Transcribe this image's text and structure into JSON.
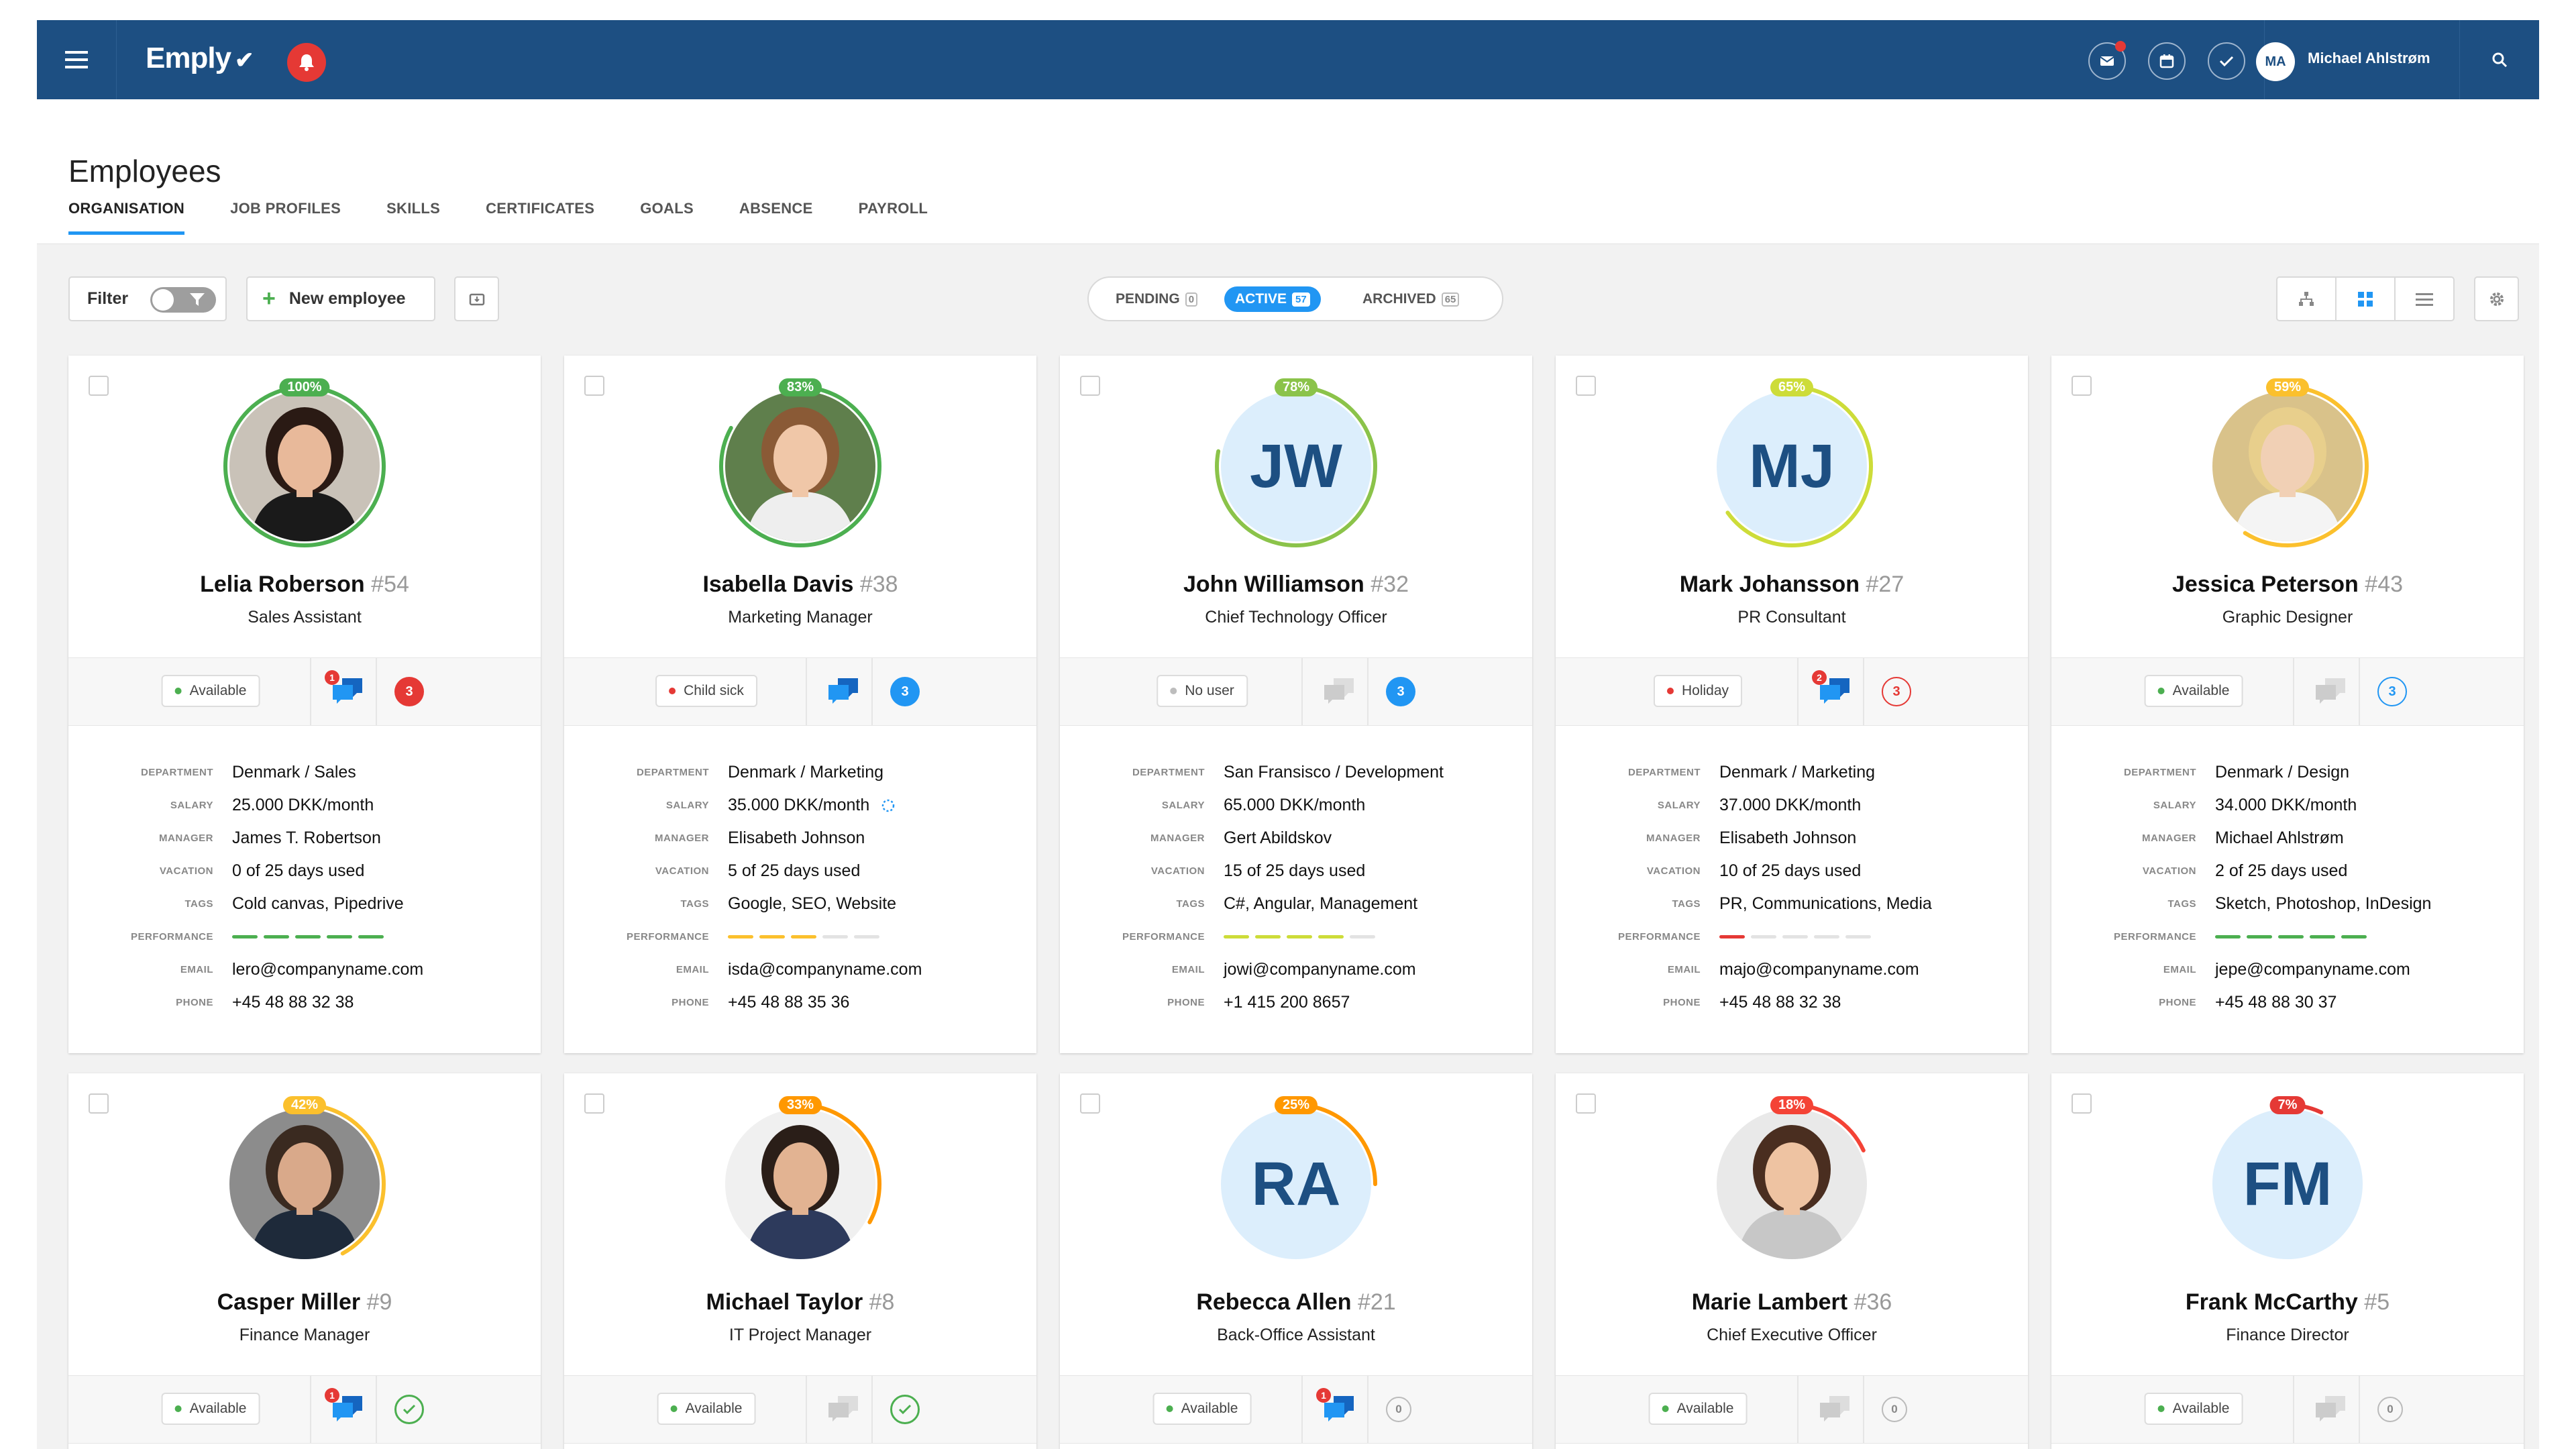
{
  "app": {
    "logo": "Emply",
    "user_initials": "MA",
    "user_name": "Michael Ahlstrøm"
  },
  "colors": {
    "brand": "#1d4f82",
    "accent": "#2196f3",
    "green": "#4caf50",
    "yellow": "#cddc39",
    "orange": "#ff9800",
    "red": "#e53935"
  },
  "header": {
    "title": "Employees",
    "tabs": [
      "ORGANISATION",
      "JOB PROFILES",
      "SKILLS",
      "CERTIFICATES",
      "GOALS",
      "ABSENCE",
      "PAYROLL"
    ]
  },
  "toolbar": {
    "filter_label": "Filter",
    "new_employee_label": "New employee",
    "segments": [
      {
        "label": "PENDING",
        "count": "0"
      },
      {
        "label": "ACTIVE",
        "count": "57"
      },
      {
        "label": "ARCHIVED",
        "count": "65"
      }
    ]
  },
  "labels": {
    "department": "DEPARTMENT",
    "salary": "SALARY",
    "manager": "MANAGER",
    "vacation": "VACATION",
    "tags": "TAGS",
    "performance": "PERFORMANCE",
    "email": "EMAIL",
    "phone": "PHONE"
  },
  "employees": [
    {
      "name": "Lelia Roberson",
      "number": "#54",
      "title": "Sales Assistant",
      "percent": "100%",
      "progress": 1.0,
      "ring_color": "#4caf50",
      "avatar_type": "photo",
      "photo_icon": "woman-dark-hair-photo",
      "status": "Available",
      "status_color": "#4caf50",
      "chat_active": true,
      "chat_badge": "1",
      "count": "3",
      "count_style": "filled-red",
      "department": "Denmark / Sales",
      "salary": "25.000 DKK/month",
      "manager": "James T. Robertson",
      "vacation": "0 of 25 days used",
      "tags": "Cold canvas, Pipedrive",
      "performance": 5,
      "performance_color": "#4caf50",
      "email": "lero@companyname.com",
      "phone": "+45 48 88 32 38"
    },
    {
      "name": "Isabella Davis",
      "number": "#38",
      "title": "Marketing Manager",
      "percent": "83%",
      "progress": 0.83,
      "ring_color": "#4caf50",
      "avatar_type": "photo",
      "photo_icon": "woman-smiling-photo",
      "status": "Child sick",
      "status_color": "#e53935",
      "chat_active": true,
      "chat_badge": "",
      "count": "3",
      "count_style": "filled-blue",
      "department": "Denmark / Marketing",
      "salary": "35.000 DKK/month",
      "salary_pending": true,
      "manager": "Elisabeth Johnson",
      "vacation": "5 of 25 days used",
      "tags": "Google, SEO, Website",
      "performance": 3,
      "performance_color": "#fbc02d",
      "email": "isda@companyname.com",
      "phone": "+45 48 88 35 36"
    },
    {
      "name": "John Williamson",
      "number": "#32",
      "title": "Chief Technology Officer",
      "percent": "78%",
      "progress": 0.78,
      "ring_color": "#8bc34a",
      "avatar_type": "initials",
      "initials": "JW",
      "status": "No user",
      "status_color": "#bdbdbd",
      "chat_active": false,
      "chat_badge": "",
      "count": "3",
      "count_style": "filled-blue",
      "department": "San Fransisco / Development",
      "salary": "65.000 DKK/month",
      "manager": "Gert Abildskov",
      "vacation": "15 of 25 days used",
      "tags": "C#, Angular, Management",
      "performance": 4,
      "performance_color": "#cddc39",
      "email": "jowi@companyname.com",
      "phone": "+1 415 200 8657"
    },
    {
      "name": "Mark Johansson",
      "number": "#27",
      "title": "PR Consultant",
      "percent": "65%",
      "progress": 0.65,
      "ring_color": "#cddc39",
      "avatar_type": "initials",
      "initials": "MJ",
      "status": "Holiday",
      "status_color": "#e53935",
      "chat_active": true,
      "chat_badge": "2",
      "count": "3",
      "count_style": "outline-red",
      "department": "Denmark / Marketing",
      "salary": "37.000 DKK/month",
      "manager": "Elisabeth Johnson",
      "vacation": "10 of 25 days used",
      "tags": "PR, Communications, Media",
      "performance": 1,
      "performance_color": "#e53935",
      "email": "majo@companyname.com",
      "phone": "+45 48 88 32 38"
    },
    {
      "name": "Jessica Peterson",
      "number": "#43",
      "title": "Graphic Designer",
      "percent": "59%",
      "progress": 0.59,
      "ring_color": "#fbc02d",
      "avatar_type": "photo",
      "photo_icon": "woman-blonde-sitting-photo",
      "status": "Available",
      "status_color": "#4caf50",
      "chat_active": false,
      "chat_badge": "",
      "count": "3",
      "count_style": "outline-blue",
      "department": "Denmark / Design",
      "salary": "34.000 DKK/month",
      "manager": "Michael Ahlstrøm",
      "vacation": "2 of 25 days used",
      "tags": "Sketch, Photoshop, InDesign",
      "performance": 5,
      "performance_color": "#4caf50",
      "email": "jepe@companyname.com",
      "phone": "+45 48 88 30 37"
    },
    {
      "name": "Casper Miller",
      "number": "#9",
      "title": "Finance Manager",
      "percent": "42%",
      "progress": 0.42,
      "ring_color": "#fbc02d",
      "avatar_type": "photo",
      "photo_icon": "man-suit-photo",
      "status": "Available",
      "status_color": "#4caf50",
      "chat_active": true,
      "chat_badge": "1",
      "count": "",
      "count_style": "check-green"
    },
    {
      "name": "Michael Taylor",
      "number": "#8",
      "title": "IT Project Manager",
      "percent": "33%",
      "progress": 0.33,
      "ring_color": "#ff9800",
      "avatar_type": "photo",
      "photo_icon": "man-smiling-photo",
      "status": "Available",
      "status_color": "#4caf50",
      "chat_active": false,
      "chat_badge": "",
      "count": "",
      "count_style": "check-green"
    },
    {
      "name": "Rebecca Allen",
      "number": "#21",
      "title": "Back-Office Assistant",
      "percent": "25%",
      "progress": 0.25,
      "ring_color": "#ff9800",
      "avatar_type": "initials",
      "initials": "RA",
      "status": "Available",
      "status_color": "#4caf50",
      "chat_active": true,
      "chat_badge": "1",
      "count": "0",
      "count_style": "outline-grey"
    },
    {
      "name": "Marie Lambert",
      "number": "#36",
      "title": "Chief Executive Officer",
      "percent": "18%",
      "progress": 0.18,
      "ring_color": "#f44336",
      "avatar_type": "photo",
      "photo_icon": "woman-office-photo",
      "status": "Available",
      "status_color": "#4caf50",
      "chat_active": false,
      "chat_badge": "",
      "count": "0",
      "count_style": "outline-grey"
    },
    {
      "name": "Frank McCarthy",
      "number": "#5",
      "title": "Finance Director",
      "percent": "7%",
      "progress": 0.07,
      "ring_color": "#e53935",
      "avatar_type": "initials",
      "initials": "FM",
      "status": "Available",
      "status_color": "#4caf50",
      "chat_active": false,
      "chat_badge": "",
      "count": "0",
      "count_style": "outline-grey"
    }
  ]
}
